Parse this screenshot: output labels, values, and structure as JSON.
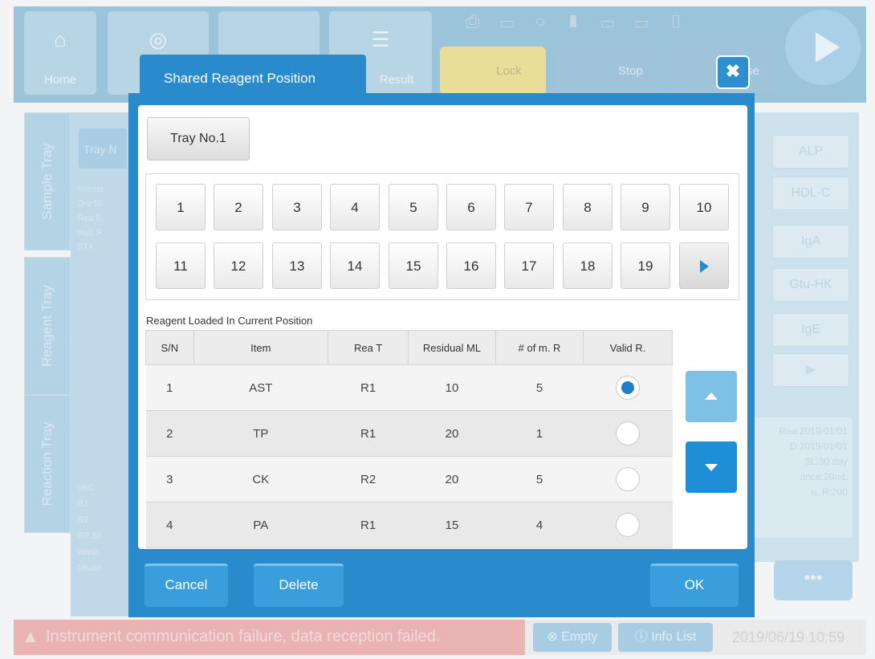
{
  "background": {
    "nav": {
      "home": "Home",
      "result": "Result",
      "lock": "Lock",
      "stop": "Stop",
      "pause": "se"
    },
    "side_tabs": [
      "Sample Tray",
      "Reagent Tray",
      "Reaction Tray"
    ],
    "legend_top": [
      "Norma",
      "O-v Sl",
      "Rea E",
      "Insh R",
      "STK"
    ],
    "legend_bottom": [
      "VAC",
      "R1",
      "R2",
      "RP Sh",
      "Wash",
      "Diluen"
    ],
    "left_label": "Tray N",
    "right_items": [
      "ALP",
      "HDL-C",
      "IgA",
      "Gtu-HK",
      "IgE"
    ],
    "right_info": [
      "Rea:2019/01/01",
      "D:2019/01/01",
      "SL:30 day",
      "ance:20mL",
      "n. R:200"
    ],
    "status": {
      "error": "Instrument communication failure, data reception failed.",
      "empty": "Empty",
      "info_list": "Info List",
      "datetime": "2019/06/19 10:59"
    }
  },
  "dialog": {
    "title": "Shared Reagent Position",
    "close_glyph": "✖",
    "tray_label": "Tray No.1",
    "positions": [
      "1",
      "2",
      "3",
      "4",
      "5",
      "6",
      "7",
      "8",
      "9",
      "10",
      "11",
      "12",
      "13",
      "14",
      "15",
      "16",
      "17",
      "18",
      "19"
    ],
    "caption": "Reagent Loaded In Current Position",
    "columns": [
      "S/N",
      "Item",
      "Rea T",
      "Residual ML",
      "# of m. R",
      "Valid R."
    ],
    "rows": [
      {
        "sn": "1",
        "item": "AST",
        "reat": "R1",
        "residual": "10",
        "mr": "5",
        "selected": true
      },
      {
        "sn": "2",
        "item": "TP",
        "reat": "R1",
        "residual": "20",
        "mr": "1",
        "selected": false
      },
      {
        "sn": "3",
        "item": "CK",
        "reat": "R2",
        "residual": "20",
        "mr": "5",
        "selected": false
      },
      {
        "sn": "4",
        "item": "PA",
        "reat": "R1",
        "residual": "15",
        "mr": "4",
        "selected": false
      }
    ],
    "buttons": {
      "cancel": "Cancel",
      "delete": "Delete",
      "ok": "OK"
    }
  },
  "colors": {
    "accent": "#2a8bcc",
    "selected_radio": "#1f7fc8"
  }
}
